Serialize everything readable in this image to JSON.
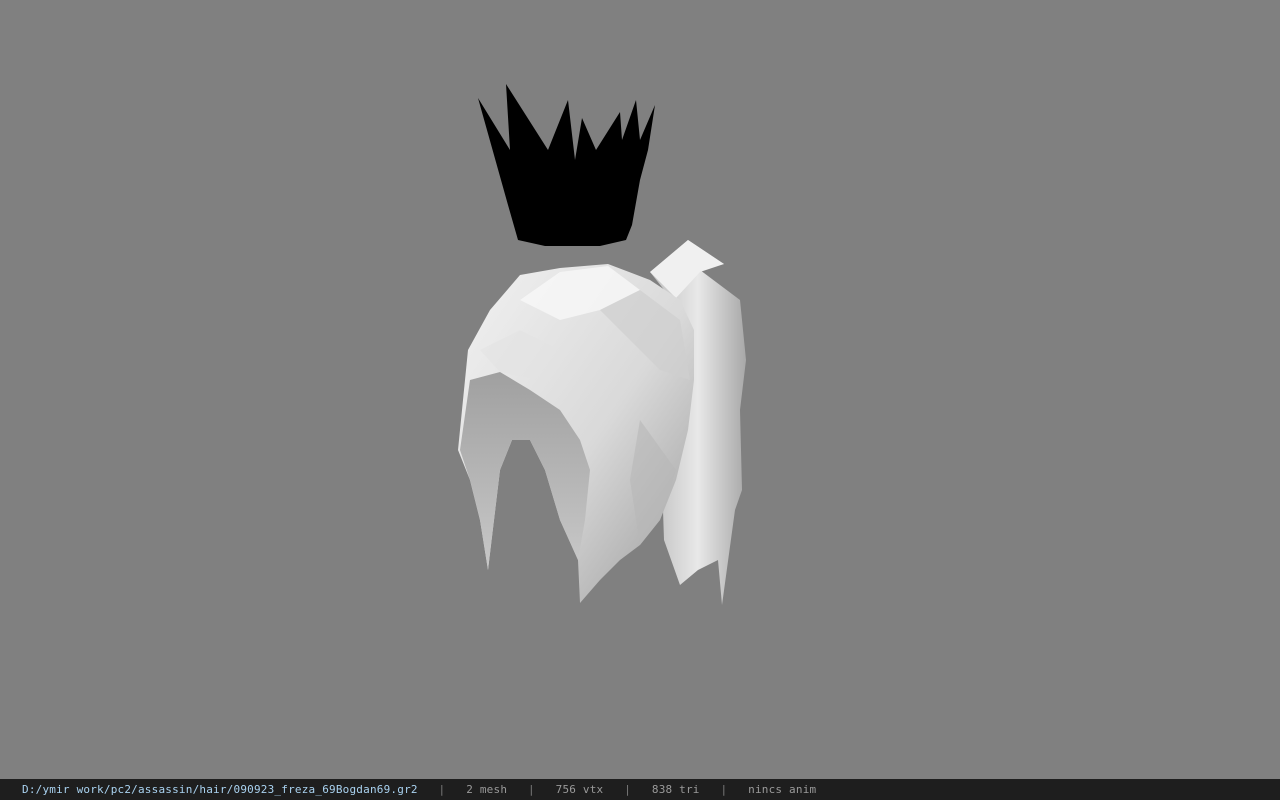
{
  "viewer": {
    "background_color": "#808080",
    "scene": {
      "meshes": [
        {
          "name": "crown-mesh",
          "color": "#000000"
        },
        {
          "name": "hair-mesh",
          "color": "#e6e6e6"
        }
      ]
    }
  },
  "status_bar": {
    "file_path": "D:/ymir work/pc2/assassin/hair/090923_freza_69Bogdan69.gr2",
    "mesh_count": "2 mesh",
    "vertex_count": "756 vtx",
    "triangle_count": "838 tri",
    "anim_status": "nincs anim",
    "separator": "|"
  }
}
